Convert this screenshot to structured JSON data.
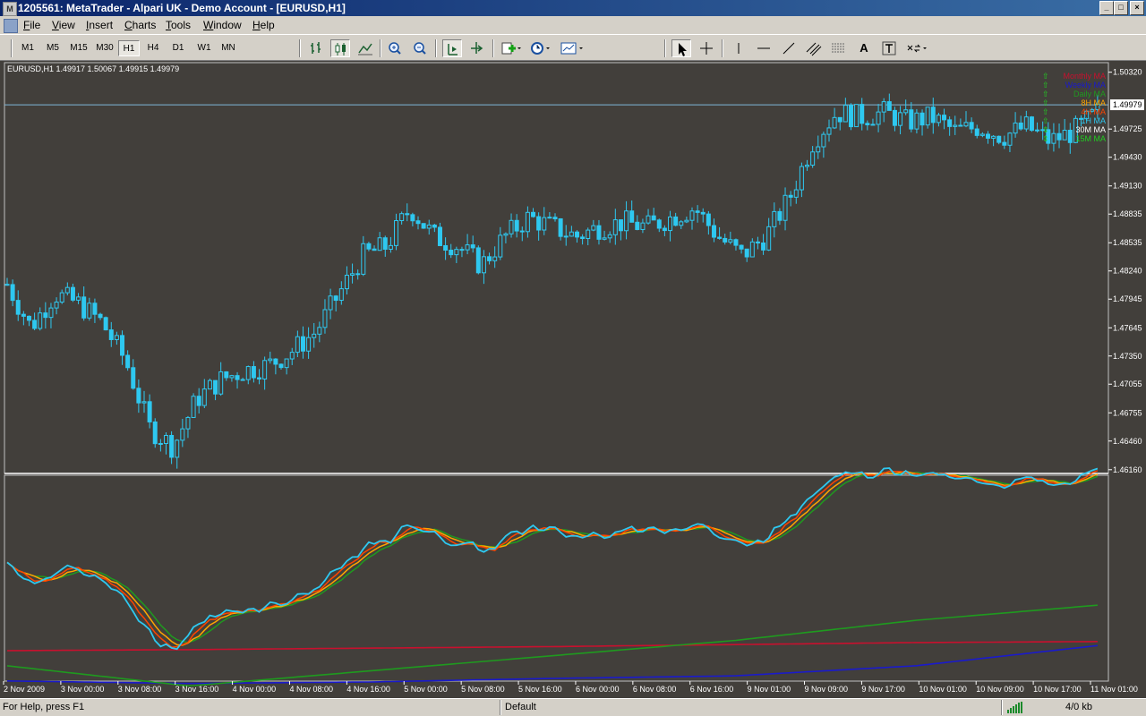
{
  "window": {
    "title": "1205561: MetaTrader - Alpari UK - Demo Account - [EURUSD,H1]",
    "icon": "metatrader-app-icon",
    "minimize": "_",
    "maximize": "□",
    "close": "×"
  },
  "menu": {
    "items": [
      "File",
      "View",
      "Insert",
      "Charts",
      "Tools",
      "Window",
      "Help"
    ]
  },
  "toolbar": {
    "timeframes": [
      "M1",
      "M5",
      "M15",
      "M30",
      "H1",
      "H4",
      "D1",
      "W1",
      "MN"
    ],
    "active_timeframe": "H1",
    "icons": [
      "bar-chart-icon",
      "candlestick-icon",
      "line-chart-icon",
      "zoom-in-icon",
      "zoom-out-icon",
      "chart-shift-icon",
      "autoscroll-icon",
      "indicators-icon",
      "periodicity-icon",
      "templates-icon",
      "cursor-icon",
      "crosshair-icon",
      "vertical-line-icon",
      "horizontal-line-icon",
      "trendline-icon",
      "equidistant-channel-icon",
      "fibonacci-icon",
      "text-icon",
      "text-label-icon",
      "arrows-icon"
    ],
    "text_tool": "A"
  },
  "chart": {
    "symbol_info": "EURUSD,H1  1.49917 1.50067 1.49915 1.49979",
    "current_price": "1.49979",
    "price_axis": [
      "1.50320",
      "1.49979",
      "1.49725",
      "1.49430",
      "1.49130",
      "1.48835",
      "1.48535",
      "1.48240",
      "1.47945",
      "1.47645",
      "1.47350",
      "1.47055",
      "1.46755",
      "1.46460",
      "1.46160"
    ],
    "time_axis": [
      "2 Nov 2009",
      "3 Nov 00:00",
      "3 Nov 08:00",
      "3 Nov 16:00",
      "4 Nov 00:00",
      "4 Nov 08:00",
      "4 Nov 16:00",
      "5 Nov 00:00",
      "5 Nov 08:00",
      "5 Nov 16:00",
      "6 Nov 00:00",
      "6 Nov 08:00",
      "6 Nov 16:00",
      "9 Nov 01:00",
      "9 Nov 09:00",
      "9 Nov 17:00",
      "10 Nov 01:00",
      "10 Nov 09:00",
      "10 Nov 17:00",
      "11 Nov 01:00"
    ],
    "ma_legend": [
      {
        "label": "Monthly MA",
        "color": "#c8102e"
      },
      {
        "label": "Weekly MA",
        "color": "#1a1acc"
      },
      {
        "label": "Daily MA",
        "color": "#1f9a1f"
      },
      {
        "label": "8H MA",
        "color": "#ffa500"
      },
      {
        "label": "4H MA",
        "color": "#ff4500"
      },
      {
        "label": "1H MA",
        "color": "#2ec8f0"
      },
      {
        "label": "30M MA",
        "color": "#ffffff"
      },
      {
        "label": "15M MA",
        "color": "#22cc22"
      }
    ],
    "candle_color": "#2ec8f0",
    "background": "#423f3b"
  },
  "chart_data": {
    "type": "candlestick",
    "symbol": "EURUSD",
    "timeframe": "H1",
    "ylim": [
      1.4613,
      1.5042
    ],
    "x_labels": [
      "2 Nov 2009",
      "3 Nov 00:00",
      "3 Nov 08:00",
      "3 Nov 16:00",
      "4 Nov 00:00",
      "4 Nov 08:00",
      "4 Nov 16:00",
      "5 Nov 00:00",
      "5 Nov 08:00",
      "5 Nov 16:00",
      "6 Nov 00:00",
      "6 Nov 08:00",
      "6 Nov 16:00",
      "9 Nov 01:00",
      "9 Nov 09:00",
      "9 Nov 17:00",
      "10 Nov 01:00",
      "10 Nov 09:00",
      "10 Nov 17:00",
      "11 Nov 01:00"
    ],
    "close_path": [
      1.481,
      1.4765,
      1.48,
      1.479,
      1.477,
      1.473,
      1.466,
      1.464,
      1.469,
      1.471,
      1.472,
      1.4725,
      1.474,
      1.476,
      1.48,
      1.484,
      1.485,
      1.489,
      1.486,
      1.485,
      1.483,
      1.486,
      1.488,
      1.487,
      1.486,
      1.487,
      1.4875,
      1.487,
      1.488,
      1.489,
      1.486,
      1.484,
      1.486,
      1.49,
      1.496,
      1.499,
      1.4985,
      1.499,
      1.498,
      1.4985,
      1.497,
      1.4975,
      1.4965,
      1.4975,
      1.496,
      1.497,
      1.499
    ],
    "ma_series": [
      {
        "name": "Monthly MA",
        "color": "#c8102e",
        "values": [
          1.468,
          1.4682,
          1.4685,
          1.4688,
          1.4692,
          1.4696,
          1.4698
        ]
      },
      {
        "name": "Weekly MA",
        "color": "#1a1acc",
        "values": [
          1.462,
          1.4615,
          1.4618,
          1.4625,
          1.463,
          1.465,
          1.469
        ]
      },
      {
        "name": "Daily MA",
        "color": "#1f9a1f",
        "values": [
          1.465,
          1.461,
          1.464,
          1.467,
          1.47,
          1.474,
          1.477
        ]
      }
    ]
  },
  "status": {
    "help": "For Help, press F1",
    "profile": "Default",
    "traffic": "4/0 kb"
  }
}
